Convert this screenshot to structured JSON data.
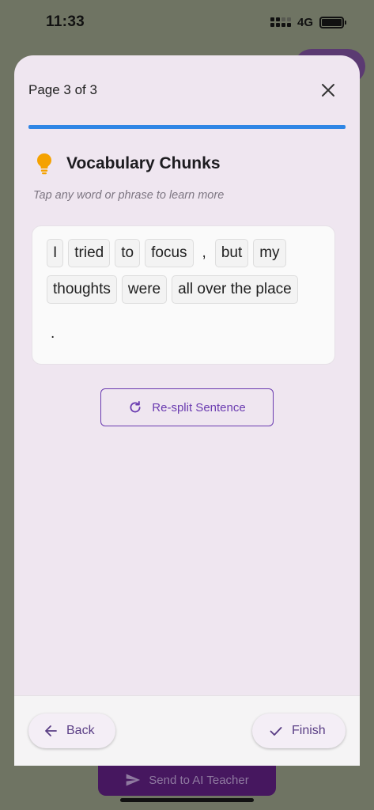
{
  "status_bar": {
    "time": "11:33",
    "network": "4G"
  },
  "sheet": {
    "page_label": "Page 3 of 3",
    "progress_fraction": 1.0,
    "section_title": "Vocabulary Chunks",
    "hint": "Tap any word or phrase to learn more",
    "chunks": [
      "I",
      "tried",
      "to",
      "focus",
      ",",
      "but",
      "my",
      "thoughts",
      "were",
      "all over the place",
      "."
    ],
    "resplit_label": "Re-split Sentence",
    "back_label": "Back",
    "finish_label": "Finish"
  },
  "background": {
    "send_button_label": "Send to AI Teacher"
  },
  "colors": {
    "accent": "#6a3bb0",
    "progress": "#2f86e5",
    "bulb": "#f5a200",
    "sheet_bg": "#efe6f0"
  },
  "icons": {
    "close": "close-icon",
    "bulb": "lightbulb-icon",
    "refresh": "refresh-icon",
    "back": "arrow-left-icon",
    "finish": "check-icon",
    "send": "send-icon"
  }
}
